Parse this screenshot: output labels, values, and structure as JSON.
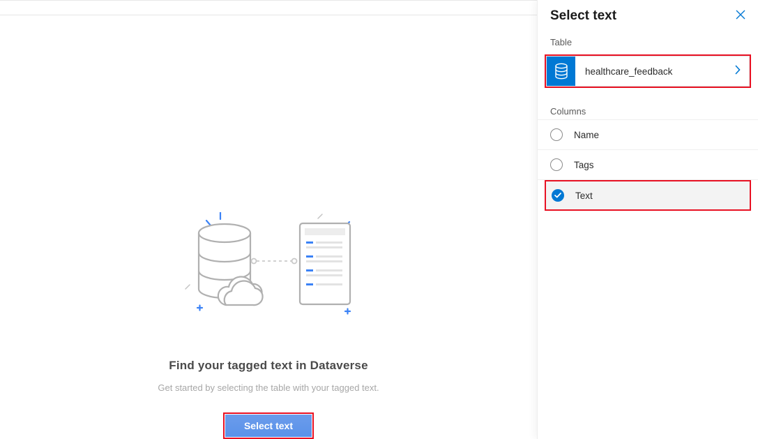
{
  "main": {
    "title": "Find your tagged text in Dataverse",
    "subtitle": "Get started by selecting the table with your tagged text.",
    "button_label": "Select text"
  },
  "panel": {
    "title": "Select text",
    "table_section_label": "Table",
    "table_name": "healthcare_feedback",
    "columns_section_label": "Columns",
    "columns": [
      {
        "label": "Name",
        "selected": false
      },
      {
        "label": "Tags",
        "selected": false
      },
      {
        "label": "Text",
        "selected": true
      }
    ]
  },
  "colors": {
    "accent": "#0078d4",
    "highlight_border": "#e81123"
  }
}
